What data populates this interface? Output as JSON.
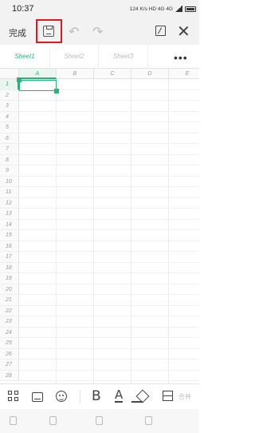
{
  "status_bar": {
    "time": "10:37",
    "indicators": "124 K/s HD 4G 4G"
  },
  "toolbar": {
    "done_label": "完成",
    "icons": [
      "save-icon",
      "undo-icon",
      "redo-icon",
      "edit-icon",
      "close-icon"
    ],
    "highlight_color": "#e0191f"
  },
  "sheets": {
    "tabs": [
      "Sheet1",
      "Sheet2",
      "Sheet3"
    ],
    "active_index": 0,
    "accent_color": "#2fb07a"
  },
  "grid": {
    "columns": [
      "A",
      "B",
      "C",
      "D",
      "E"
    ],
    "rows": [
      "1",
      "2",
      "3",
      "4",
      "5",
      "6",
      "7",
      "8",
      "9",
      "10",
      "11",
      "12",
      "13",
      "14",
      "15",
      "16",
      "17",
      "18",
      "19",
      "20",
      "21",
      "22",
      "23",
      "24",
      "25",
      "26",
      "27",
      "28"
    ],
    "selected_cell": "A1"
  },
  "format_toolbar": {
    "bold_label": "B",
    "font_color_label": "A",
    "more_label": "合并",
    "icons": [
      "apps-icon",
      "keyboard-icon",
      "emoji-icon",
      "bold-icon",
      "font-color-icon",
      "fill-color-icon",
      "border-icon"
    ]
  }
}
